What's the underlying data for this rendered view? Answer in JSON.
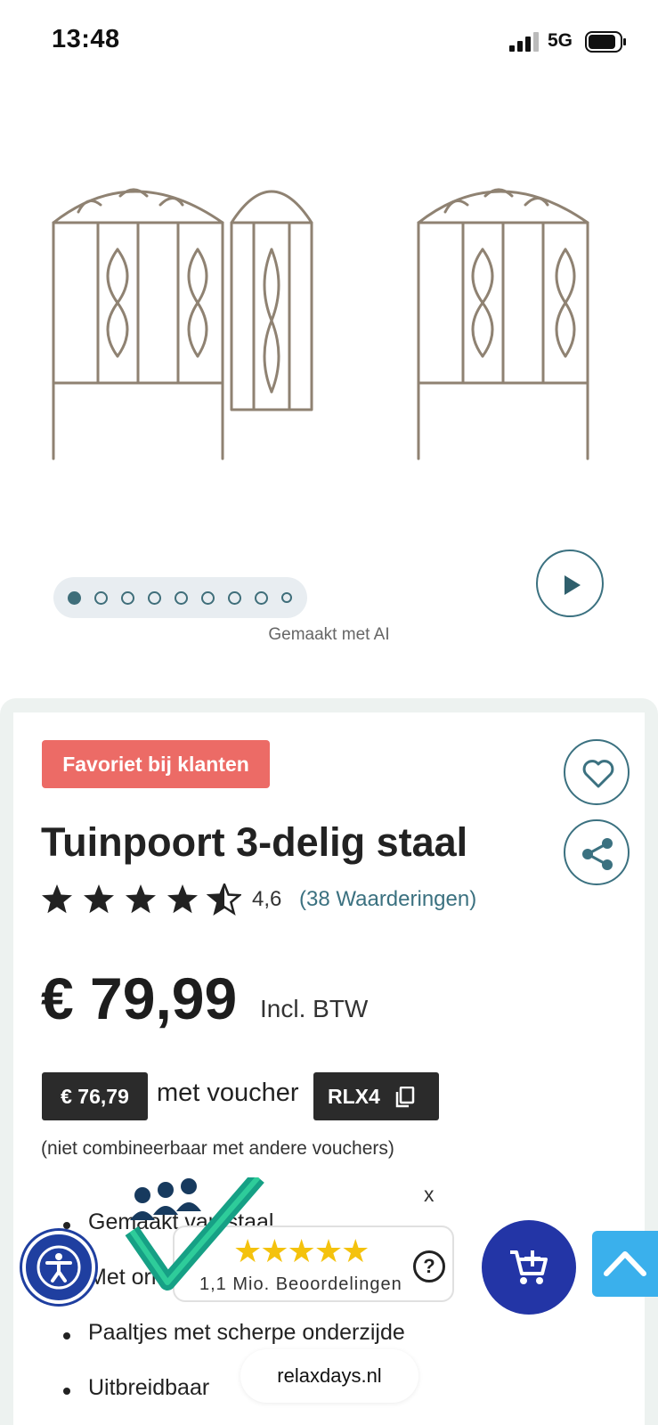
{
  "status_bar": {
    "time": "13:48",
    "network": "5G"
  },
  "gallery": {
    "dot_count": 9,
    "active_dot": 0,
    "ai_label": "Gemaakt met AI",
    "icons": {
      "play": "play-icon"
    }
  },
  "product": {
    "badge": "Favoriet bij klanten",
    "title": "Tuinpoort 3-delig staal",
    "rating": 4.6,
    "rating_text": "4,6",
    "reviews_link": "(38 Waarderingen)",
    "price": "€ 79,99",
    "vat_label": "Incl. BTW",
    "voucher_price": "€ 76,79",
    "voucher_text": "met voucher",
    "voucher_code": "RLX4",
    "voucher_note": "(niet combineerbaar met andere vouchers)",
    "features": [
      "Gemaakt van staal",
      "Met ornamenten",
      "Paaltjes met scherpe onderzijde",
      "Uitbreidbaar"
    ]
  },
  "trust_widget": {
    "close_label": "x",
    "stars": "★★★★★",
    "count_text": "1,1 Mio. Beoordelingen",
    "help_label": "?"
  },
  "footer": {
    "domain": "relaxdays.nl"
  },
  "colors": {
    "accent": "#3b7180",
    "badge": "#ec6b66",
    "cart": "#2335a6",
    "accessibility": "#1f3fa0",
    "scroll_top": "#3ab0ec",
    "star_gold": "#f4c20d"
  }
}
